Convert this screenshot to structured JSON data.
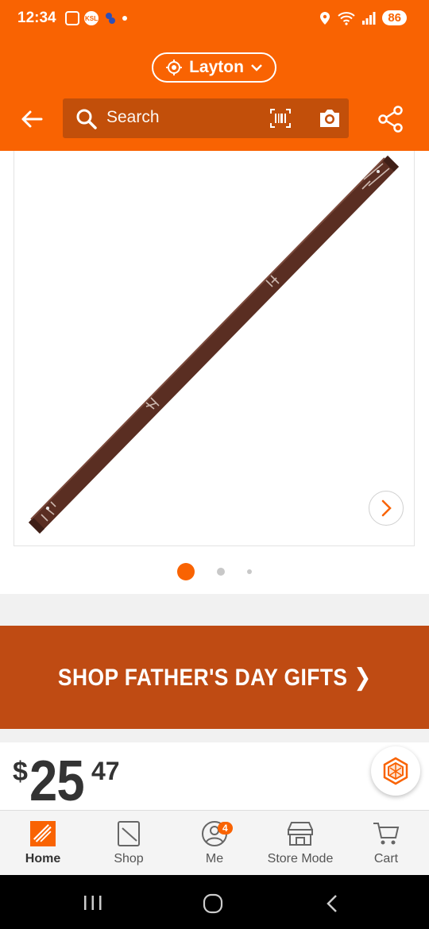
{
  "status_bar": {
    "time": "12:34",
    "ksl_label": "KSL",
    "battery": "86"
  },
  "header": {
    "location": "Layton",
    "search_placeholder": "Search"
  },
  "product": {
    "carousel_pages": 3,
    "active_page": 1
  },
  "promo": {
    "text": "SHOP FATHER'S DAY GIFTS ❯"
  },
  "price": {
    "currency": "$",
    "dollars": "25",
    "cents": "47"
  },
  "bottom_nav": {
    "items": [
      {
        "label": "Home",
        "icon": "home-depot-logo-icon",
        "active": true
      },
      {
        "label": "Shop",
        "icon": "shop-icon"
      },
      {
        "label": "Me",
        "icon": "person-icon",
        "badge": "4"
      },
      {
        "label": "Store Mode",
        "icon": "store-icon"
      },
      {
        "label": "Cart",
        "icon": "cart-icon"
      }
    ]
  },
  "colors": {
    "brand_orange": "#f96302",
    "promo_orange": "#bf4b13",
    "search_bg": "#c24f0a"
  }
}
